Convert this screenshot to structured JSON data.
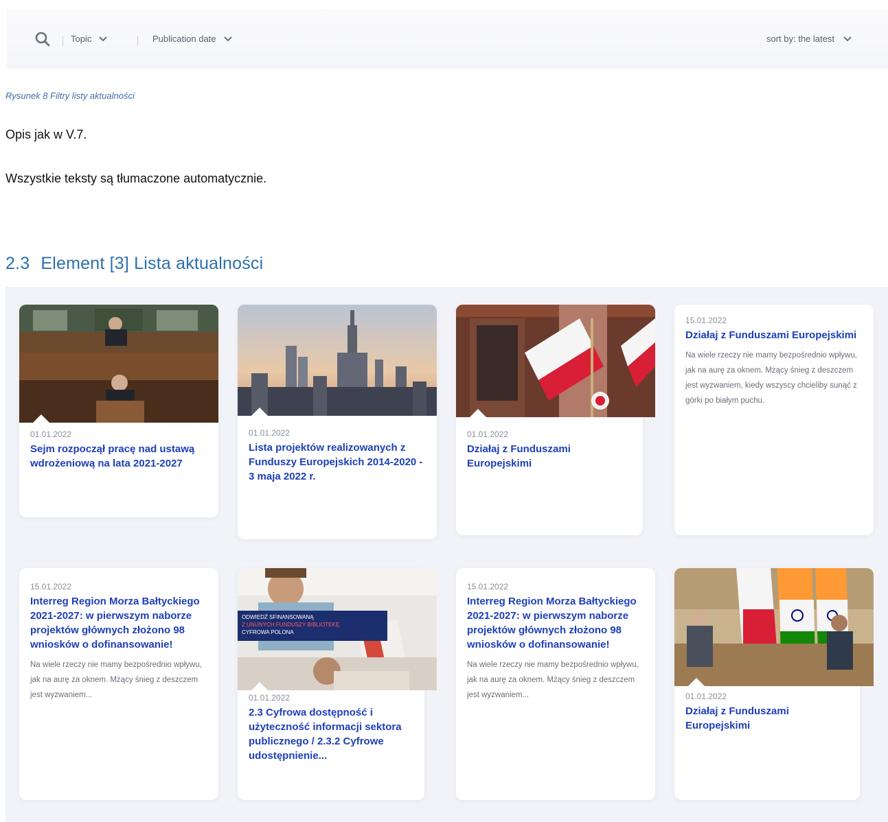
{
  "filters": {
    "topic_label": "Topic",
    "date_label": "Publication date",
    "sort_label": "sort by: the latest"
  },
  "caption": "Rysunek 8 Filtry listy aktualności",
  "paragraphs": {
    "p1": "Opis jak w V.7.",
    "p2": "Wszystkie teksty są tłumaczone automatycznie."
  },
  "section": {
    "number": "2.3",
    "title": "Element [3] Lista aktualności"
  },
  "cards": [
    {
      "date": "01.01.2022",
      "title": "Sejm rozpoczął pracę nad ustawą wdrożeniową na lata 2021-2027",
      "image": "sejm-photo"
    },
    {
      "date": "01.01.2022",
      "title": "Lista projektów realizowanych z Funduszy Europejskich 2014-2020 - 3 maja 2022 r.",
      "image": "warsaw-skyline-photo"
    },
    {
      "date": "01.01.2022",
      "title": "Działaj z Funduszami Europejskimi",
      "image": "polish-flags-photo"
    },
    {
      "date": "15.01.2022",
      "title": "Działaj z Funduszami Europejskimi",
      "text": "Na wiele rzeczy nie mamy bezpośrednio wpływu, jak na aurę za oknem. Mżący śnieg z deszczem jest wyzwaniem, kiedy wszyscy chcieliby sunąć z górki po białym puchu."
    },
    {
      "date": "15.01.2022",
      "title": "Interreg Region Morza Bałtyckiego 2021-2027: w pierwszym naborze projektów głównych złożono 98 wniosków o dofinansowanie!",
      "text": "Na wiele rzeczy nie mamy bezpośrednio wpływu, jak na aurę za oknem. Mżący śnieg z deszczem jest wyzwaniem..."
    },
    {
      "date": "01.01.2022",
      "title": "2.3 Cyfrowa dostępność i użyteczność informacji sektora publicznego / 2.3.2 Cyfrowe udostępnienie...",
      "image": "digital-library-photo",
      "banner": [
        "ODWIEDŹ SFINANSOWANĄ",
        "Z UNIJNYCH FUNDUSZY BIBLIOTEKĘ",
        "CYFROWA POLONA"
      ]
    },
    {
      "date": "15.01.2022",
      "title": "Interreg Region Morza Bałtyckiego 2021-2027: w pierwszym naborze projektów głównych złożono 98 wniosków o dofinansowanie!",
      "text": "Na wiele rzeczy nie mamy bezpośrednio wpływu, jak na aurę za oknem. Mżący śnieg z deszczem jest wyzwaniem..."
    },
    {
      "date": "01.01.2022",
      "title": "Działaj z Funduszami Europejskimi",
      "image": "diplomatic-meeting-photo"
    }
  ]
}
